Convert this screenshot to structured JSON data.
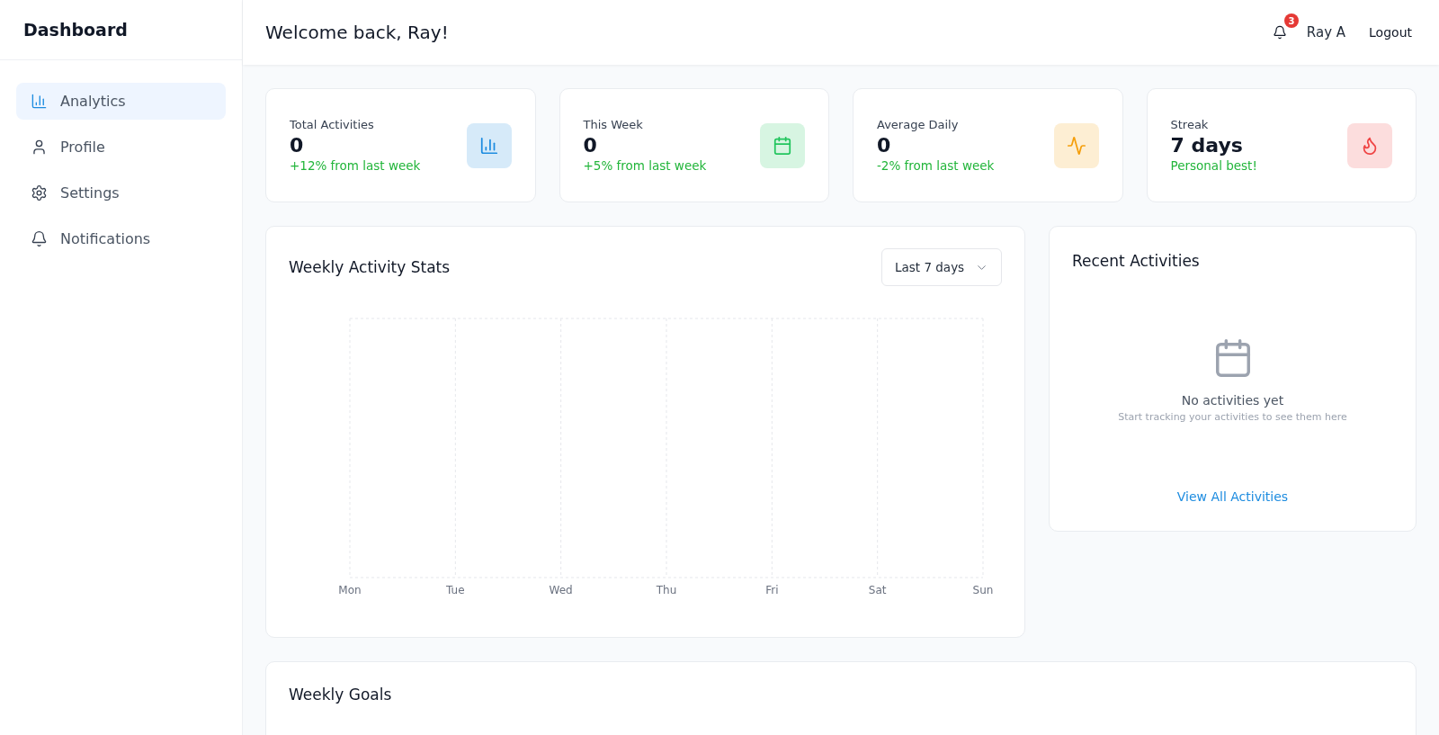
{
  "sidebar": {
    "title": "Dashboard",
    "items": [
      {
        "label": "Analytics",
        "selected": true
      },
      {
        "label": "Profile",
        "selected": false
      },
      {
        "label": "Settings",
        "selected": false
      },
      {
        "label": "Notifications",
        "selected": false
      }
    ]
  },
  "header": {
    "greeting": "Welcome back, Ray!",
    "notification_count": "3",
    "user": "Ray A",
    "logout": "Logout"
  },
  "stats": [
    {
      "label": "Total Activities",
      "value": "0",
      "change": "+12% from last week",
      "color": "#1d8ce0"
    },
    {
      "label": "This Week",
      "value": "0",
      "change": "+5% from last week",
      "color": "#22c55e"
    },
    {
      "label": "Average Daily",
      "value": "0",
      "change": "-2% from last week",
      "color": "#f59e0b"
    },
    {
      "label": "Streak",
      "value": "7 days",
      "change": "Personal best!",
      "color": "#ef4444"
    }
  ],
  "weekly_chart": {
    "title": "Weekly Activity Stats",
    "range": "Last 7 days",
    "x_labels": [
      "Mon",
      "Tue",
      "Wed",
      "Thu",
      "Fri",
      "Sat",
      "Sun"
    ]
  },
  "recent": {
    "title": "Recent Activities",
    "empty_title": "No activities yet",
    "empty_hint": "Start tracking your activities to see them here",
    "link": "View All Activities"
  },
  "goals": {
    "title": "Weekly Goals"
  }
}
